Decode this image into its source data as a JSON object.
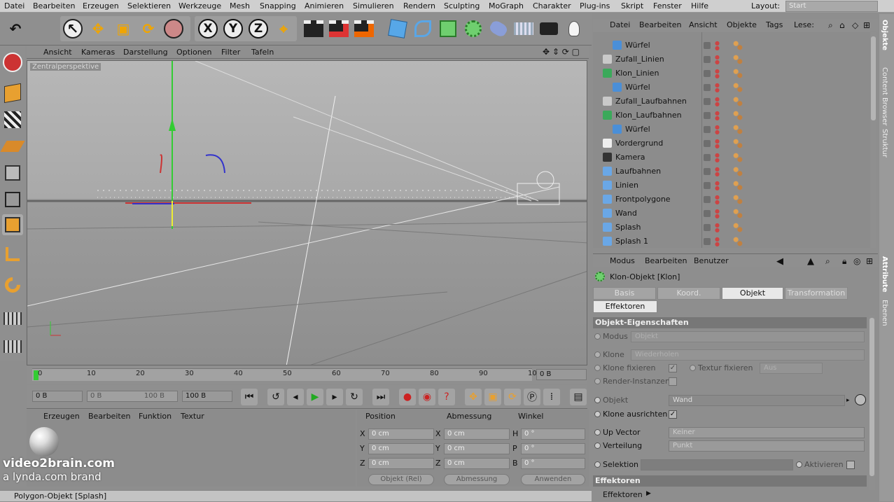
{
  "menu": [
    "Datei",
    "Bearbeiten",
    "Erzeugen",
    "Selektieren",
    "Werkzeuge",
    "Mesh",
    "Snapping",
    "Animieren",
    "Simulieren",
    "Rendern",
    "Sculpting",
    "MoGraph",
    "Charakter",
    "Plug-ins",
    "Skript",
    "Fenster",
    "Hilfe"
  ],
  "layout": {
    "label": "Layout:",
    "value": "Start"
  },
  "toolbar": {
    "undo": "↶",
    "select": "↖",
    "move": "✥",
    "scale": "▣",
    "rotate": "⟳",
    "x": "X",
    "y": "Y",
    "z": "Z"
  },
  "viewport": {
    "menu": [
      "Ansicht",
      "Kameras",
      "Darstellung",
      "Optionen",
      "Filter",
      "Tafeln"
    ],
    "label": "Zentralperspektive"
  },
  "timeline": {
    "ticks": [
      "0",
      "10",
      "20",
      "30",
      "40",
      "50",
      "60",
      "70",
      "80",
      "90",
      "10"
    ],
    "current": "0 B"
  },
  "playback": {
    "start": "0 B",
    "range_start": "0 B",
    "range_end": "100 B",
    "end": "100 B"
  },
  "material": {
    "menu": [
      "Erzeugen",
      "Bearbeiten",
      "Funktion",
      "Textur"
    ]
  },
  "coords": {
    "headers": [
      "Position",
      "Abmessung",
      "Winkel"
    ],
    "pos": [
      {
        "l": "X",
        "v": "0 cm"
      },
      {
        "l": "Y",
        "v": "0 cm"
      },
      {
        "l": "Z",
        "v": "0 cm"
      }
    ],
    "size": [
      {
        "l": "X",
        "v": "0 cm"
      },
      {
        "l": "Y",
        "v": "0 cm"
      },
      {
        "l": "Z",
        "v": "0 cm"
      }
    ],
    "rot": [
      {
        "l": "H",
        "v": "0 °"
      },
      {
        "l": "P",
        "v": "0 °"
      },
      {
        "l": "B",
        "v": "0 °"
      }
    ],
    "mode": "Objekt (Rel)",
    "measure": "Abmessung",
    "apply": "Anwenden"
  },
  "watermark": {
    "line1": "video2brain.com",
    "line2": "a lynda.com brand"
  },
  "status": "Polygon-Objekt [Splash]",
  "objects": {
    "menu": [
      "Datei",
      "Bearbeiten",
      "Ansicht",
      "Objekte",
      "Tags",
      "Lese:"
    ],
    "rows": [
      {
        "name": "Würfel",
        "indent": 2,
        "icon": "#4a8fd8"
      },
      {
        "name": "Zufall_Linien",
        "indent": 1,
        "icon": "#c9c9c9"
      },
      {
        "name": "Klon_Linien",
        "indent": 1,
        "icon": "#3ba95a"
      },
      {
        "name": "Würfel",
        "indent": 2,
        "icon": "#4a8fd8"
      },
      {
        "name": "Zufall_Laufbahnen",
        "indent": 1,
        "icon": "#c9c9c9"
      },
      {
        "name": "Klon_Laufbahnen",
        "indent": 1,
        "icon": "#3ba95a"
      },
      {
        "name": "Würfel",
        "indent": 2,
        "icon": "#4a8fd8"
      },
      {
        "name": "Vordergrund",
        "indent": 1,
        "icon": "#eeeeee"
      },
      {
        "name": "Kamera",
        "indent": 1,
        "icon": "#333333"
      },
      {
        "name": "Laufbahnen",
        "indent": 1,
        "icon": "#6aa7e6"
      },
      {
        "name": "Linien",
        "indent": 1,
        "icon": "#6aa7e6"
      },
      {
        "name": "Frontpolygone",
        "indent": 1,
        "icon": "#6aa7e6"
      },
      {
        "name": "Wand",
        "indent": 1,
        "icon": "#6aa7e6"
      },
      {
        "name": "Splash",
        "indent": 1,
        "icon": "#6aa7e6"
      },
      {
        "name": "Splash 1",
        "indent": 1,
        "icon": "#6aa7e6"
      }
    ]
  },
  "sidetabs": [
    "Objekte",
    "Content Browser",
    "Struktur",
    "Attribute",
    "Ebenen"
  ],
  "attributes": {
    "menu": [
      "Modus",
      "Bearbeiten",
      "Benutzer"
    ],
    "title": "Klon-Objekt [Klon]",
    "tabs": [
      "Basis",
      "Koord.",
      "Objekt",
      "Transformation",
      "Effektoren"
    ],
    "section1": "Objekt-Eigenschaften",
    "modus_label": "Modus",
    "modus_value": "Objekt",
    "klone_label": "Klone",
    "klone_value": "Wiederholen",
    "fix_label": "Klone fixieren",
    "tex_label": "Textur fixieren",
    "tex_value": "Aus",
    "inst_label": "Render-Instanzen",
    "objekt_label": "Objekt",
    "objekt_value": "Wand",
    "ausrichten_label": "Klone ausrichten",
    "up_label": "Up Vector",
    "up_value": "Keiner",
    "vert_label": "Verteilung",
    "vert_value": "Punkt",
    "sel_label": "Selektion",
    "aktiv_label": "Aktivieren",
    "section2": "Effektoren",
    "eff_label": "Effektoren"
  }
}
